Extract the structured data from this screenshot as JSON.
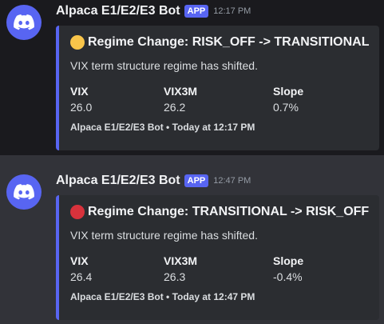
{
  "messages": [
    {
      "author": "Alpaca E1/E2/E3 Bot",
      "badge": "APP",
      "time": "12:17 PM",
      "embed": {
        "status_color": "#f9c54a",
        "title": "Regime Change: RISK_OFF -> TRANSITIONAL",
        "description": "VIX term structure regime has shifted.",
        "fields": [
          {
            "name": "VIX",
            "value": "26.0"
          },
          {
            "name": "VIX3M",
            "value": "26.2"
          },
          {
            "name": "Slope",
            "value": "0.7%"
          }
        ],
        "footer": "Alpaca E1/E2/E3 Bot • Today at 12:17 PM"
      }
    },
    {
      "author": "Alpaca E1/E2/E3 Bot",
      "badge": "APP",
      "time": "12:47 PM",
      "embed": {
        "status_color": "#d8323c",
        "title": "Regime Change: TRANSITIONAL -> RISK_OFF",
        "description": "VIX term structure regime has shifted.",
        "fields": [
          {
            "name": "VIX",
            "value": "26.4"
          },
          {
            "name": "VIX3M",
            "value": "26.3"
          },
          {
            "name": "Slope",
            "value": "-0.4%"
          }
        ],
        "footer": "Alpaca E1/E2/E3 Bot • Today at 12:47 PM"
      }
    }
  ],
  "colors": {
    "avatar_bg": "#5865f2",
    "embed_accent": "#5865f2"
  },
  "icons": {
    "avatar": "discord-logo-icon"
  }
}
